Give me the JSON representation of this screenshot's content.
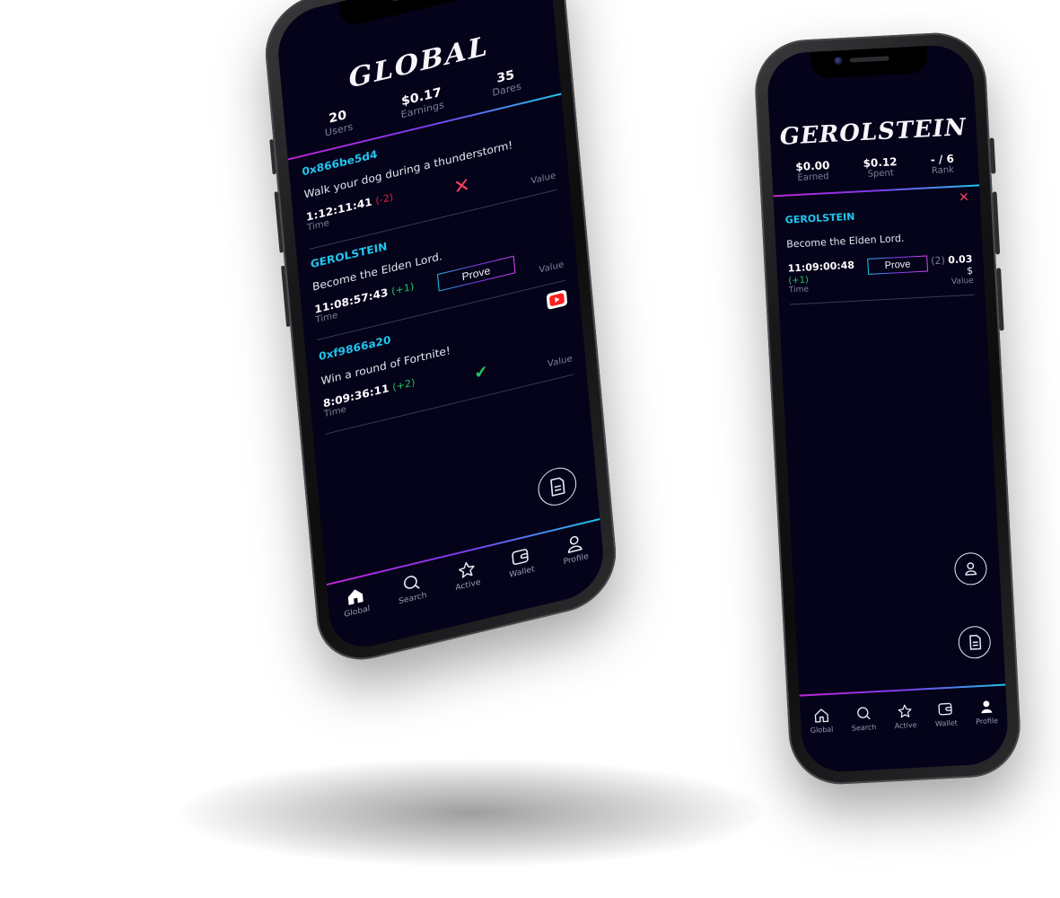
{
  "left_phone": {
    "logo": "GLOBAL",
    "stats": [
      {
        "value": "20",
        "label": "Users"
      },
      {
        "value": "$0.17",
        "label": "Earnings"
      },
      {
        "value": "35",
        "label": "Dares"
      }
    ],
    "dares": [
      {
        "address": "0x866be5d4",
        "title": "Walk your dog during a thunderstorm!",
        "time": "1:12:11:41",
        "delta": "(-2)",
        "delta_sign": "neg",
        "time_label": "Time",
        "value_label": "Value",
        "status": "x-mark"
      },
      {
        "address": "GEROLSTEIN",
        "title": "Become the Elden Lord.",
        "time": "11:08:57:43",
        "delta": "(+1)",
        "delta_sign": "pos",
        "time_label": "Time",
        "value_label": "Value",
        "action_label": "Prove"
      },
      {
        "address": "0xf9866a20",
        "title": "Win a round of Fortnite!",
        "time": "8:09:36:11",
        "delta": "(+2)",
        "delta_sign": "pos",
        "time_label": "Time",
        "value_label": "Value",
        "status": "check-mark",
        "badge_icon": "youtube-icon"
      }
    ],
    "fab_icon": "new-dare-icon",
    "tabs": [
      {
        "label": "Global",
        "icon": "home-icon",
        "active": true
      },
      {
        "label": "Search",
        "icon": "search-icon"
      },
      {
        "label": "Active",
        "icon": "star-icon"
      },
      {
        "label": "Wallet",
        "icon": "wallet-icon"
      },
      {
        "label": "Profile",
        "icon": "profile-icon"
      }
    ]
  },
  "right_phone": {
    "logo": "GEROLSTEIN",
    "stats": [
      {
        "value": "$0.00",
        "label": "Earned"
      },
      {
        "value": "$0.12",
        "label": "Spent"
      },
      {
        "value": "- / 6",
        "label": "Rank"
      }
    ],
    "dare": {
      "address": "GEROLSTEIN",
      "title": "Become the Elden Lord.",
      "time": "11:09:00:48",
      "delta": "(+1)",
      "time_label": "Time",
      "action_label": "Prove",
      "value_count": "(2)",
      "value_amount": "0.03",
      "currency": "$",
      "value_label": "Value"
    },
    "fab_icons": [
      "profile-icon",
      "new-dare-icon"
    ],
    "tabs": [
      {
        "label": "Global",
        "icon": "home-icon"
      },
      {
        "label": "Search",
        "icon": "search-icon"
      },
      {
        "label": "Active",
        "icon": "star-icon"
      },
      {
        "label": "Wallet",
        "icon": "wallet-icon"
      },
      {
        "label": "Profile",
        "icon": "profile-icon",
        "active": true
      }
    ]
  },
  "colors": {
    "screen_bg": "#04031a",
    "accent_cyan": "#22c5ee",
    "accent_magenta": "#d946ef",
    "negative": "#e11d48",
    "positive": "#22c55e"
  }
}
